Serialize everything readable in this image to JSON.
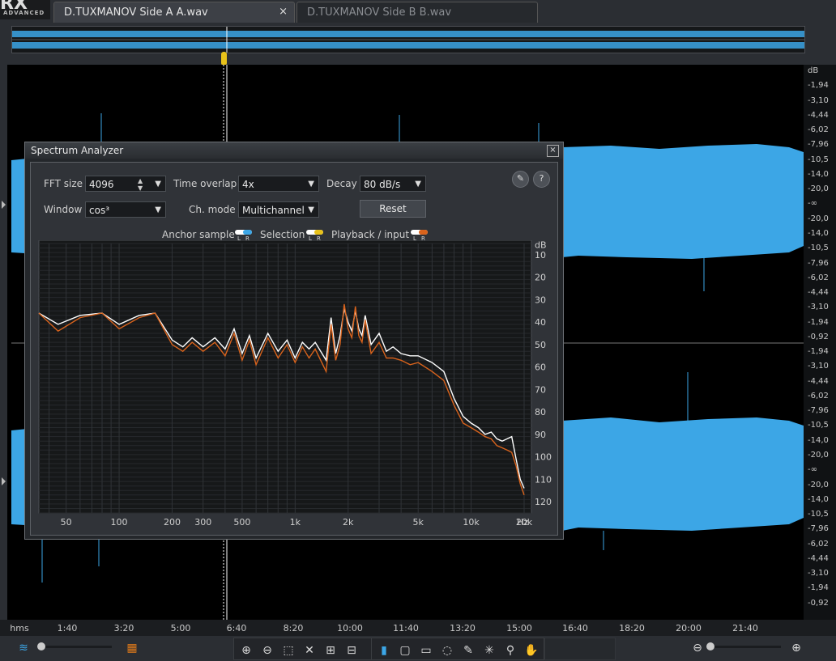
{
  "app": {
    "logo_text": "RX",
    "logo_sub": "ADVANCED"
  },
  "tabs": [
    {
      "label": "D.TUXMANOV Side A A.wav",
      "active": true,
      "close": "×"
    },
    {
      "label": "D.TUXMANOV Side B B.wav",
      "active": false
    }
  ],
  "db_axis": [
    "dB",
    "-1,94",
    "-3,10",
    "-4,44",
    "-6,02",
    "-7,96",
    "-10,5",
    "-14,0",
    "-20,0",
    "-∞",
    "-20,0",
    "-14,0",
    "-10,5",
    "-7,96",
    "-6,02",
    "-4,44",
    "-3,10",
    "-1,94",
    "-0,92",
    "-1,94",
    "-3,10",
    "-4,44",
    "-6,02",
    "-7,96",
    "-10,5",
    "-14,0",
    "-20,0",
    "-∞",
    "-20,0",
    "-14,0",
    "-10,5",
    "-7,96",
    "-6,02",
    "-4,44",
    "-3,10",
    "-1,94",
    "-0,92"
  ],
  "time_axis": [
    "hms",
    "1:40",
    "3:20",
    "5:00",
    "6:40",
    "8:20",
    "10:00",
    "11:40",
    "13:20",
    "15:00",
    "16:40",
    "18:20",
    "20:00",
    "21:40"
  ],
  "colors": {
    "waveform": "#3ca6e6",
    "accent": "#e8c21a",
    "white_trace": "#ffffff",
    "orange_trace": "#d9631c"
  },
  "toolbar_icons": [
    "waveform-icon",
    "spectrogram-icon",
    "zoom-in-time-icon",
    "zoom-out-time-icon",
    "zoom-selection-icon",
    "zoom-reset-icon",
    "zoom-in-freq-icon",
    "zoom-out-freq-icon",
    "time-select-icon",
    "rect-select-icon",
    "freq-select-icon",
    "lasso-icon",
    "brush-icon",
    "magic-wand-icon",
    "find-similar-icon",
    "hand-icon",
    "zoom-out-icon",
    "zoom-in-icon"
  ],
  "dialog": {
    "title": "Spectrum Analyzer",
    "close": "×",
    "fft_size_label": "FFT size",
    "fft_size": "4096",
    "time_overlap_label": "Time overlap",
    "time_overlap": "4x",
    "decay_label": "Decay",
    "decay": "80 dB/s",
    "window_label": "Window",
    "window": "cos³",
    "ch_mode_label": "Ch. mode",
    "ch_mode": "Multichannel",
    "reset": "Reset",
    "settings_icon": "wrench-icon",
    "help": "?",
    "anchor_label": "Anchor sample",
    "selection_label": "Selection",
    "playback_label": "Playback / input",
    "l": "L",
    "r": "R"
  },
  "chart_data": {
    "type": "line",
    "xscale": "log",
    "xticks": [
      "50",
      "100",
      "200",
      "300",
      "500",
      "1k",
      "2k",
      "5k",
      "10k",
      "20k",
      "Hz"
    ],
    "yticks": [
      "dB",
      "10",
      "20",
      "30",
      "40",
      "50",
      "60",
      "70",
      "80",
      "90",
      "100",
      "110",
      "120"
    ],
    "ylim": [
      -125,
      -5
    ],
    "xlim": [
      35,
      22000
    ],
    "grid": true,
    "series": [
      {
        "color": "#ffffff",
        "x": [
          35,
          45,
          60,
          80,
          100,
          130,
          160,
          200,
          230,
          260,
          300,
          350,
          400,
          450,
          500,
          550,
          600,
          700,
          800,
          900,
          1000,
          1100,
          1200,
          1300,
          1500,
          1600,
          1700,
          1800,
          1900,
          2000,
          2100,
          2200,
          2300,
          2400,
          2500,
          2700,
          3000,
          3300,
          3600,
          4000,
          4500,
          5000,
          6000,
          7000,
          8000,
          9000,
          10000,
          11000,
          12000,
          13000,
          14000,
          15000,
          16000,
          17000,
          18000,
          19000,
          20000
        ],
        "y": [
          -36,
          -41,
          -37,
          -36,
          -41,
          -37,
          -36,
          -48,
          -51,
          -47,
          -51,
          -47,
          -52,
          -43,
          -54,
          -46,
          -56,
          -45,
          -53,
          -48,
          -56,
          -49,
          -52,
          -49,
          -57,
          -38,
          -54,
          -46,
          -34,
          -40,
          -44,
          -35,
          -43,
          -46,
          -37,
          -50,
          -45,
          -53,
          -51,
          -54,
          -55,
          -55,
          -58,
          -62,
          -74,
          -82,
          -85,
          -87,
          -90,
          -89,
          -92,
          -93,
          -92,
          -91,
          -101,
          -110,
          -114
        ]
      },
      {
        "color": "#d9631c",
        "x": [
          35,
          45,
          60,
          80,
          100,
          130,
          160,
          200,
          230,
          260,
          300,
          350,
          400,
          450,
          500,
          550,
          600,
          700,
          800,
          900,
          1000,
          1100,
          1200,
          1300,
          1500,
          1600,
          1700,
          1800,
          1900,
          2000,
          2100,
          2200,
          2300,
          2400,
          2500,
          2700,
          3000,
          3300,
          3600,
          4000,
          4500,
          5000,
          6000,
          7000,
          8000,
          9000,
          10000,
          11000,
          12000,
          13000,
          14000,
          15000,
          16000,
          17000,
          18000,
          19000,
          20000
        ],
        "y": [
          -36,
          -44,
          -38,
          -36,
          -43,
          -38,
          -36,
          -50,
          -53,
          -49,
          -53,
          -49,
          -55,
          -45,
          -57,
          -48,
          -59,
          -47,
          -56,
          -50,
          -58,
          -51,
          -56,
          -52,
          -62,
          -41,
          -57,
          -50,
          -32,
          -43,
          -47,
          -33,
          -46,
          -49,
          -39,
          -54,
          -49,
          -56,
          -56,
          -57,
          -59,
          -58,
          -62,
          -66,
          -77,
          -85,
          -87,
          -89,
          -91,
          -92,
          -95,
          -96,
          -97,
          -98,
          -104,
          -112,
          -117
        ]
      }
    ]
  }
}
